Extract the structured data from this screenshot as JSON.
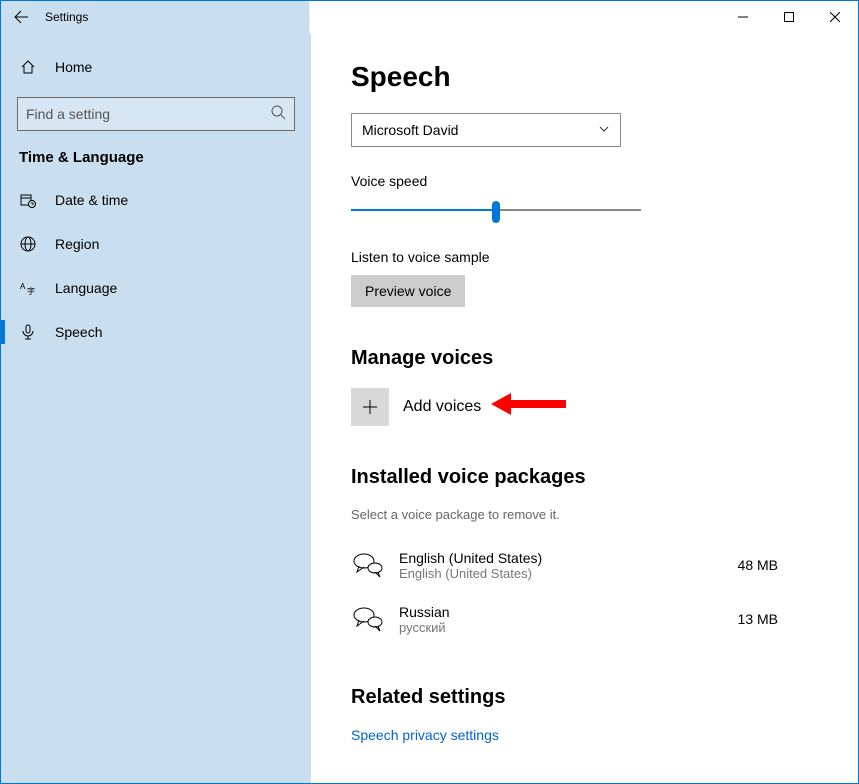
{
  "window": {
    "title": "Settings"
  },
  "sidebar": {
    "home_label": "Home",
    "search_placeholder": "Find a setting",
    "category": "Time & Language",
    "items": [
      {
        "label": "Date & time"
      },
      {
        "label": "Region"
      },
      {
        "label": "Language"
      },
      {
        "label": "Speech"
      }
    ]
  },
  "page": {
    "title": "Speech",
    "voice_select": "Microsoft David",
    "speed_label": "Voice speed",
    "listen_label": "Listen to voice sample",
    "preview_button": "Preview voice",
    "manage_section": "Manage voices",
    "add_voices": "Add voices",
    "installed_section": "Installed voice packages",
    "installed_hint": "Select a voice package to remove it.",
    "packages": [
      {
        "name": "English (United States)",
        "sub": "English (United States)",
        "size": "48 MB"
      },
      {
        "name": "Russian",
        "sub": "русский",
        "size": "13 MB"
      }
    ],
    "related_section": "Related settings",
    "related_link": "Speech privacy settings"
  }
}
